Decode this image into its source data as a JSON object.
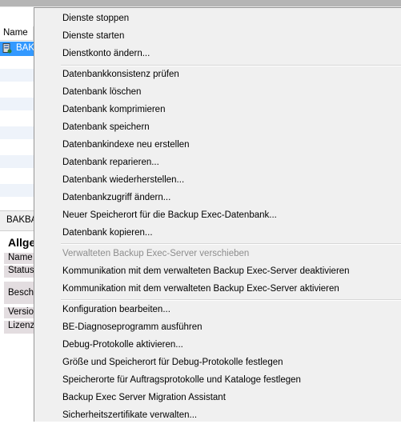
{
  "background": {
    "list_header_label": "Name",
    "selected_server_label": "BAKB",
    "details_title": "BAKBA",
    "group_title": "Allge",
    "properties": [
      {
        "label": "Name"
      },
      {
        "label": "Status"
      },
      {
        "label": "Besch"
      },
      {
        "label": "Versio"
      },
      {
        "label": "Lizenz"
      }
    ]
  },
  "menu": {
    "group1": [
      {
        "label": "Dienste stoppen"
      },
      {
        "label": "Dienste starten"
      },
      {
        "label": "Dienstkonto ändern..."
      }
    ],
    "group2": [
      {
        "label": "Datenbankkonsistenz prüfen"
      },
      {
        "label": "Datenbank löschen"
      },
      {
        "label": "Datenbank komprimieren"
      },
      {
        "label": "Datenbank speichern"
      },
      {
        "label": "Datenbankindexe neu erstellen"
      },
      {
        "label": "Datenbank reparieren..."
      },
      {
        "label": "Datenbank wiederherstellen..."
      },
      {
        "label": "Datenbankzugriff ändern..."
      },
      {
        "label": "Neuer Speicherort für die Backup Exec-Datenbank..."
      },
      {
        "label": "Datenbank kopieren..."
      }
    ],
    "group3": [
      {
        "label": "Verwalteten Backup Exec-Server verschieben",
        "disabled": true
      },
      {
        "label": "Kommunikation mit dem verwalteten Backup Exec-Server deaktivieren"
      },
      {
        "label": "Kommunikation mit dem verwalteten Backup Exec-Server aktivieren"
      }
    ],
    "group4": [
      {
        "label": "Konfiguration bearbeiten..."
      },
      {
        "label": "BE-Diagnoseprogramm ausführen"
      },
      {
        "label": "Debug-Protokolle aktivieren..."
      },
      {
        "label": "Größe und Speicherort für Debug-Protokolle festlegen"
      },
      {
        "label": "Speicherorte für Auftragsprotokolle und Kataloge festlegen"
      },
      {
        "label": "Backup Exec Server Migration Assistant"
      },
      {
        "label": "Sicherheitszertifikate verwalten..."
      }
    ]
  }
}
